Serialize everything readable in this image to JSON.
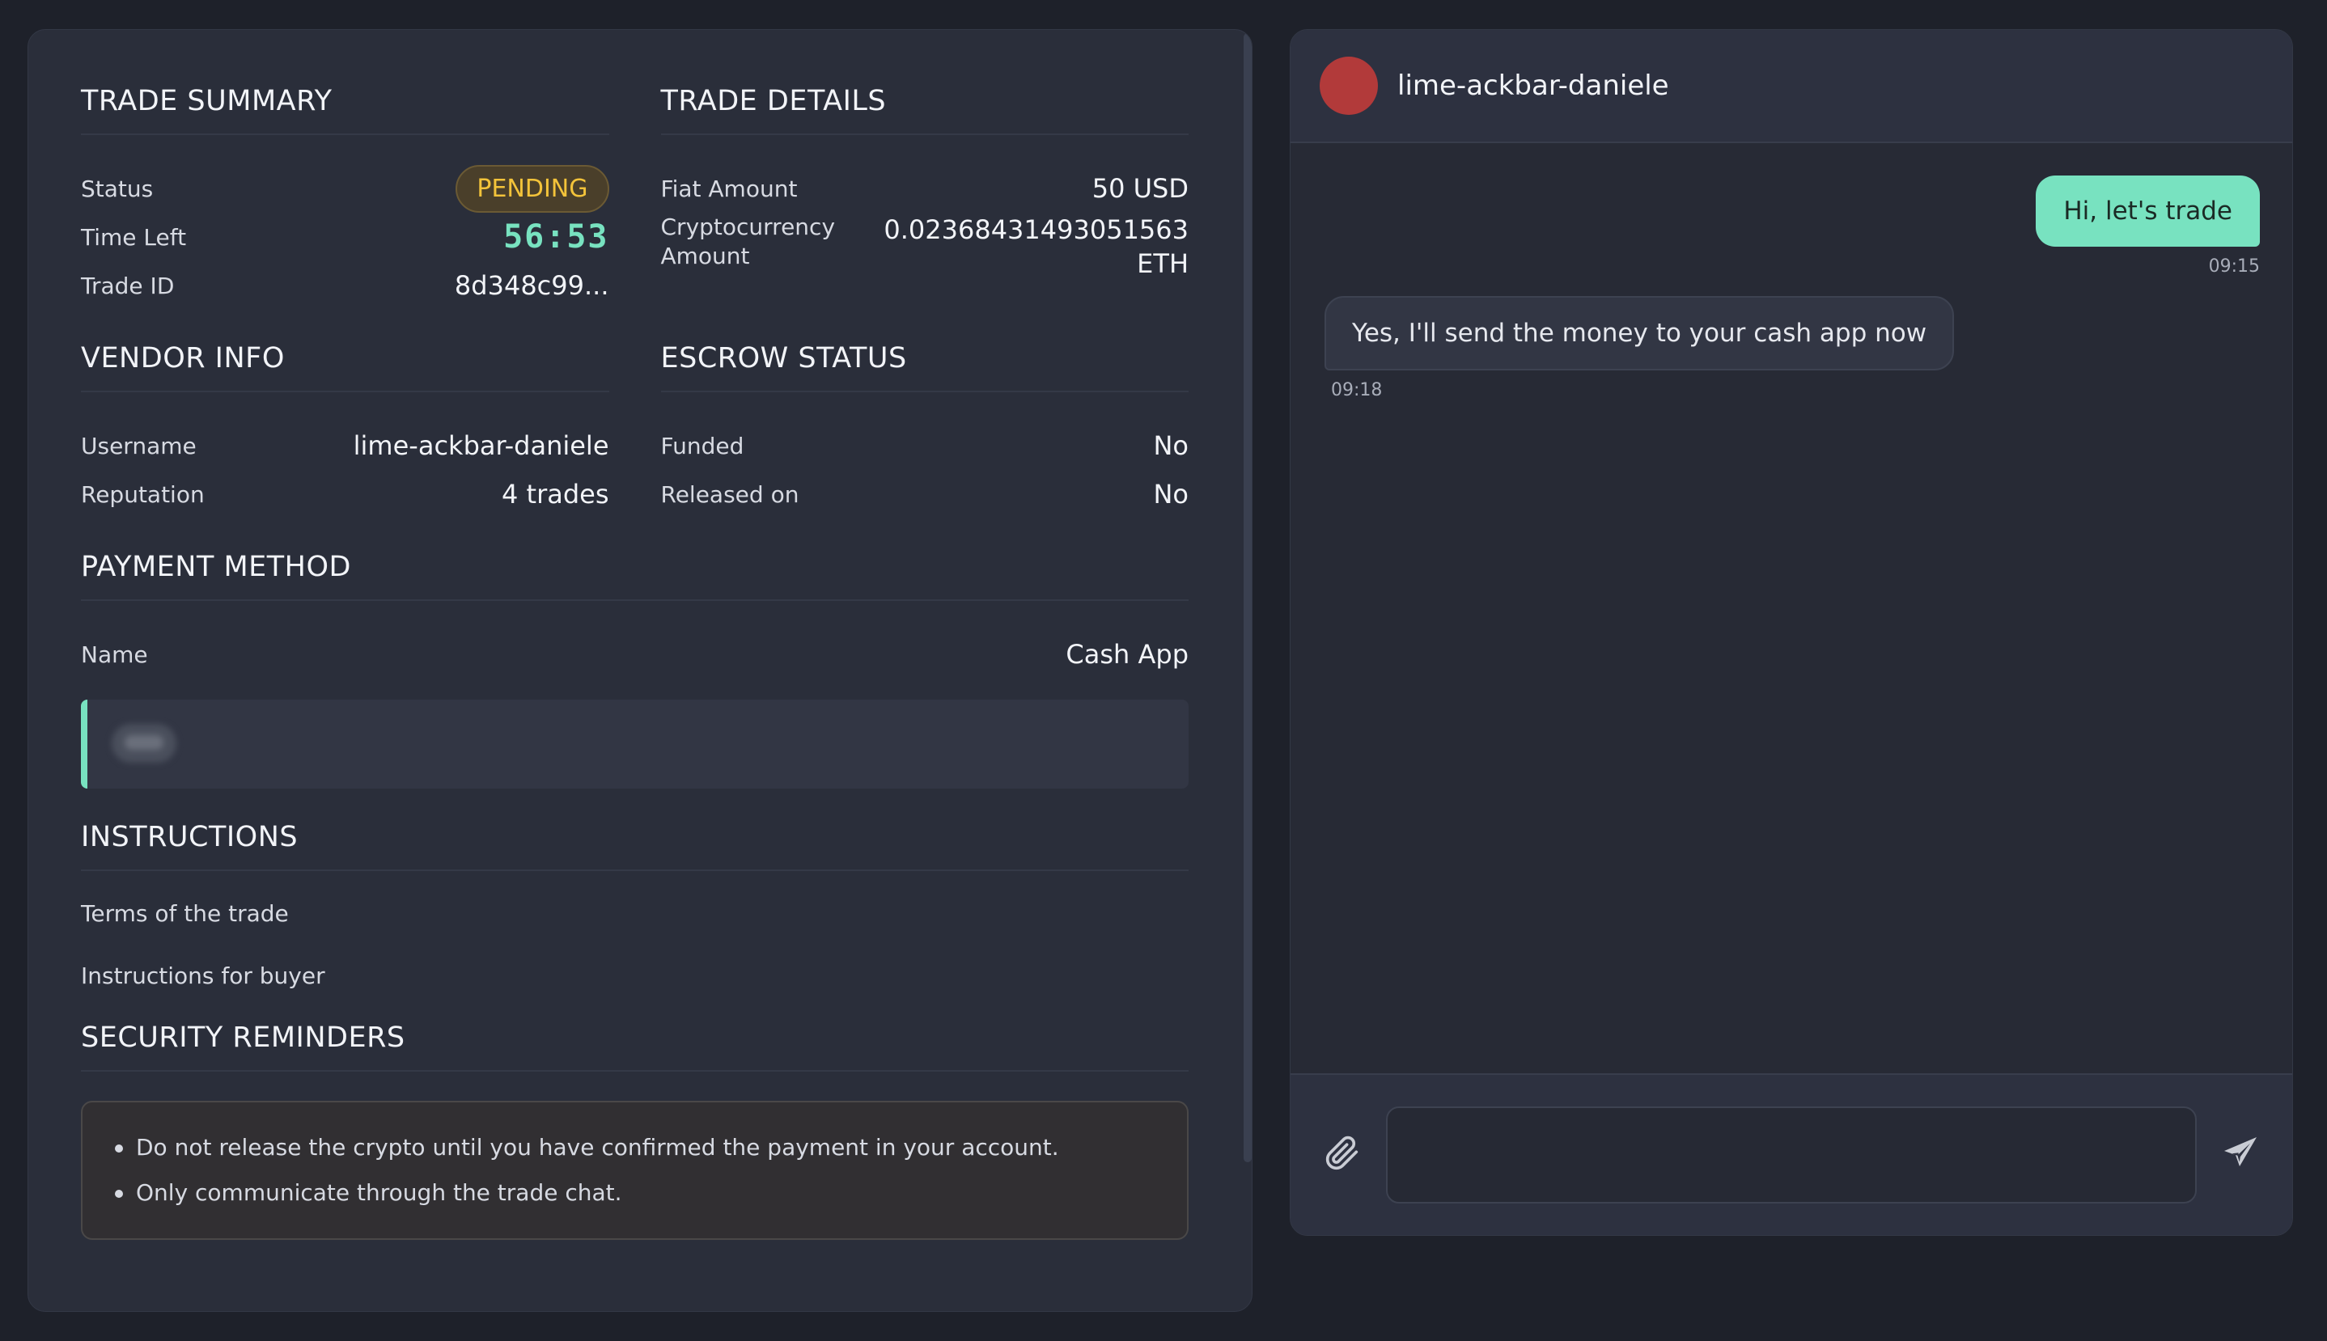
{
  "trade_summary": {
    "title": "TRADE SUMMARY",
    "status_label": "Status",
    "status_value": "PENDING",
    "time_left_label": "Time Left",
    "time_left_value": "56:53",
    "trade_id_label": "Trade ID",
    "trade_id_value": "8d348c99..."
  },
  "trade_details": {
    "title": "TRADE DETAILS",
    "fiat_label": "Fiat Amount",
    "fiat_value": "50 USD",
    "crypto_label": "Cryptocurrency Amount",
    "crypto_value": "0.02368431493051563 ETH"
  },
  "vendor_info": {
    "title": "VENDOR INFO",
    "username_label": "Username",
    "username_value": "lime-ackbar-daniele",
    "reputation_label": "Reputation",
    "reputation_value": "4 trades"
  },
  "escrow_status": {
    "title": "ESCROW STATUS",
    "funded_label": "Funded",
    "funded_value": "No",
    "released_label": "Released on",
    "released_value": "No"
  },
  "payment_method": {
    "title": "PAYMENT METHOD",
    "name_label": "Name",
    "name_value": "Cash App"
  },
  "instructions": {
    "title": "INSTRUCTIONS",
    "terms": "Terms of the trade",
    "buyer": "Instructions for buyer"
  },
  "security": {
    "title": "SECURITY REMINDERS",
    "items": [
      "Do not release the crypto until you have confirmed the payment in your account.",
      "Only communicate through the trade chat."
    ]
  },
  "chat": {
    "partner_name": "lime-ackbar-daniele",
    "messages": [
      {
        "text": "Hi, let's trade",
        "time": "09:15"
      },
      {
        "text": "Yes, I'll send the money to your cash app now",
        "time": "09:18"
      }
    ],
    "input_placeholder": ""
  },
  "colors": {
    "accent": "#78e2c0",
    "pending": "#f3c33a",
    "avatar": "#b23a3a",
    "background": "#1e212a",
    "panel": "#2a2e3a"
  },
  "icons": {
    "attach": "paperclip-icon",
    "send": "send-icon"
  }
}
